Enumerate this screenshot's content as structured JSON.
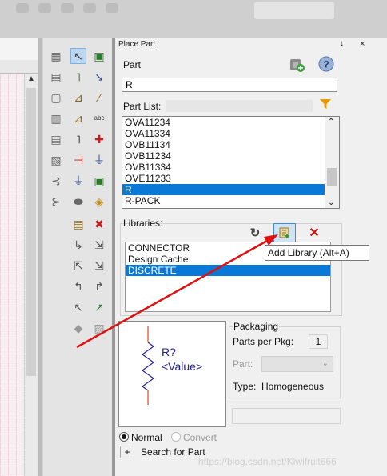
{
  "panel": {
    "title": "Place Part",
    "pin_glyph": "↓",
    "close_glyph": "×"
  },
  "part": {
    "label": "Part",
    "value": "R"
  },
  "part_list": {
    "label": "Part List:",
    "items": [
      "OVA11234",
      "OVA11334",
      "OVB11134",
      "OVB11234",
      "OVB11334",
      "OVE11233",
      "R",
      "R-PACK"
    ],
    "selected_index": 6
  },
  "libraries": {
    "label": "Libraries:",
    "items": [
      "CONNECTOR",
      "Design Cache",
      "DISCRETE"
    ],
    "selected_index": 2,
    "tooltip": "Add Library (Alt+A)"
  },
  "preview": {
    "ref": "R?",
    "value": "<Value>"
  },
  "packaging": {
    "title": "Packaging",
    "parts_per_pkg_label": "Parts per Pkg:",
    "parts_per_pkg_value": "1",
    "part_label": "Part:",
    "type_label": "Type:",
    "type_value": "Homogeneous"
  },
  "bottom": {
    "normal_label": "Normal",
    "convert_label": "Convert",
    "plus_label": "+",
    "search_label": "Search for Part"
  },
  "watermark": "https://blog.csdn.net/Kiwifruit666",
  "icons": {
    "filter": "filter-icon",
    "refresh": "refresh-icon",
    "add_library": "add-library-icon",
    "remove": "remove-library-icon",
    "help": "help-icon",
    "add_part": "add-part-icon"
  },
  "colors": {
    "selection": "#0a78d7",
    "annotation_arrow": "#e01010",
    "remove_x": "#c01818"
  }
}
